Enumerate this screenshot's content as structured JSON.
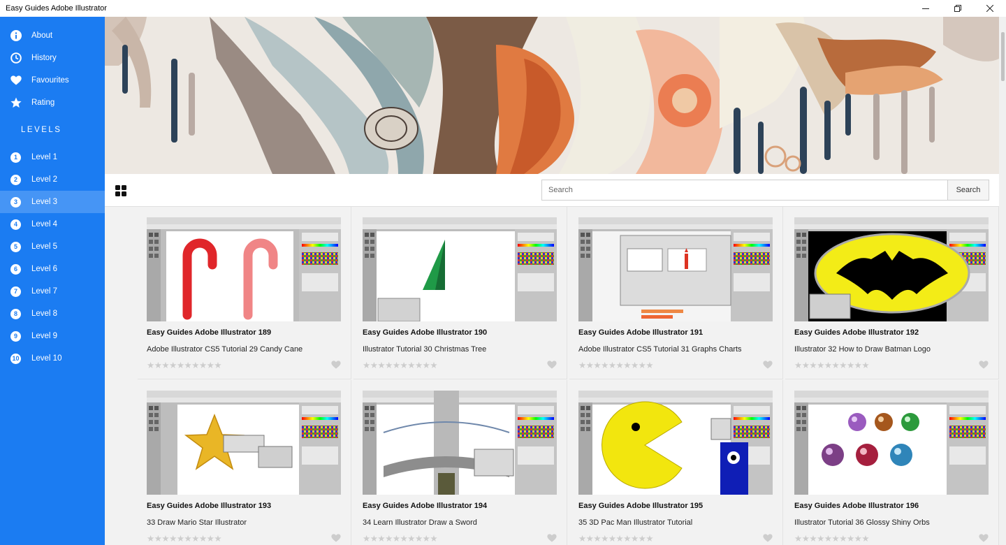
{
  "window": {
    "title": "Easy Guides Adobe Illustrator"
  },
  "sidebar": {
    "menu": [
      {
        "label": "About",
        "icon": "info-icon"
      },
      {
        "label": "History",
        "icon": "clock-icon"
      },
      {
        "label": "Favourites",
        "icon": "heart-icon"
      },
      {
        "label": "Rating",
        "icon": "star-icon"
      }
    ],
    "levels_heading": "LEVELS",
    "levels": [
      {
        "num": "1",
        "label": "Level 1"
      },
      {
        "num": "2",
        "label": "Level 2"
      },
      {
        "num": "3",
        "label": "Level 3",
        "active": true
      },
      {
        "num": "4",
        "label": "Level 4"
      },
      {
        "num": "5",
        "label": "Level 5"
      },
      {
        "num": "6",
        "label": "Level 6"
      },
      {
        "num": "7",
        "label": "Level 7"
      },
      {
        "num": "8",
        "label": "Level 8"
      },
      {
        "num": "9",
        "label": "Level 9"
      },
      {
        "num": "10",
        "label": "Level 10"
      }
    ]
  },
  "toolbar": {
    "search_placeholder": "Search",
    "search_button": "Search"
  },
  "cards": [
    {
      "title": "Easy Guides Adobe Illustrator 189",
      "subtitle": "Adobe Illustrator CS5 Tutorial 29 Candy Cane",
      "thumb": "candy-cane"
    },
    {
      "title": "Easy Guides Adobe Illustrator 190",
      "subtitle": "Illustrator Tutorial 30 Christmas Tree",
      "thumb": "christmas-tree"
    },
    {
      "title": "Easy Guides Adobe Illustrator 191",
      "subtitle": "Adobe Illustrator CS5 Tutorial 31 Graphs Charts",
      "thumb": "graphs-charts"
    },
    {
      "title": "Easy Guides Adobe Illustrator 192",
      "subtitle": "Illustrator 32 How to Draw Batman Logo",
      "thumb": "batman-logo"
    },
    {
      "title": "Easy Guides Adobe Illustrator 193",
      "subtitle": "33 Draw Mario Star Illustrator",
      "thumb": "mario-star"
    },
    {
      "title": "Easy Guides Adobe Illustrator 194",
      "subtitle": "34 Learn Illustrator Draw a Sword",
      "thumb": "sword"
    },
    {
      "title": "Easy Guides Adobe Illustrator 195",
      "subtitle": "35 3D Pac Man Illustrator Tutorial",
      "thumb": "pac-man"
    },
    {
      "title": "Easy Guides Adobe Illustrator 196",
      "subtitle": "Illustrator Tutorial 36 Glossy Shiny Orbs",
      "thumb": "glossy-orbs"
    }
  ],
  "rating": {
    "stars": "★★★★★★★★★★"
  },
  "colors": {
    "sidebar": "#1b7cf2",
    "sidebar_active": "#4695f5",
    "page_bg": "#f2f2f2"
  }
}
